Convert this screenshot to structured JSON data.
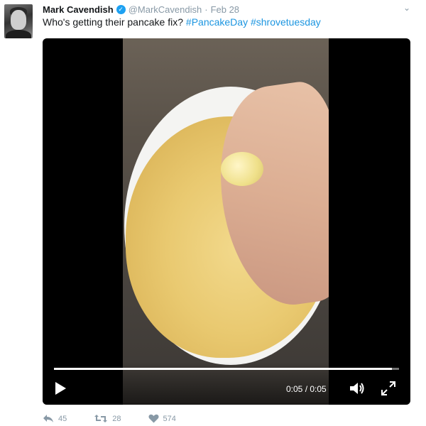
{
  "tweet": {
    "author_name": "Mark Cavendish",
    "handle": "@MarkCavendish",
    "separator": "·",
    "date": "Feb 28",
    "text_prefix": "Who's getting their pancake fix? ",
    "hashtags": [
      "#PancakeDay",
      "#shrovetuesday"
    ]
  },
  "video": {
    "time_readout": "0:05 / 0:05",
    "progress": 0.98
  },
  "actions": {
    "reply_count": "45",
    "retweet_count": "28",
    "like_count": "574"
  },
  "icons": {
    "verified": "verified-badge-icon",
    "menu": "chevron-down-icon",
    "play": "play-icon",
    "volume": "volume-icon",
    "fullscreen": "fullscreen-icon",
    "reply": "reply-icon",
    "retweet": "retweet-icon",
    "like": "heart-icon"
  },
  "colors": {
    "link": "#1b95e0",
    "verified": "#1da1f2",
    "muted": "#8899a6"
  }
}
